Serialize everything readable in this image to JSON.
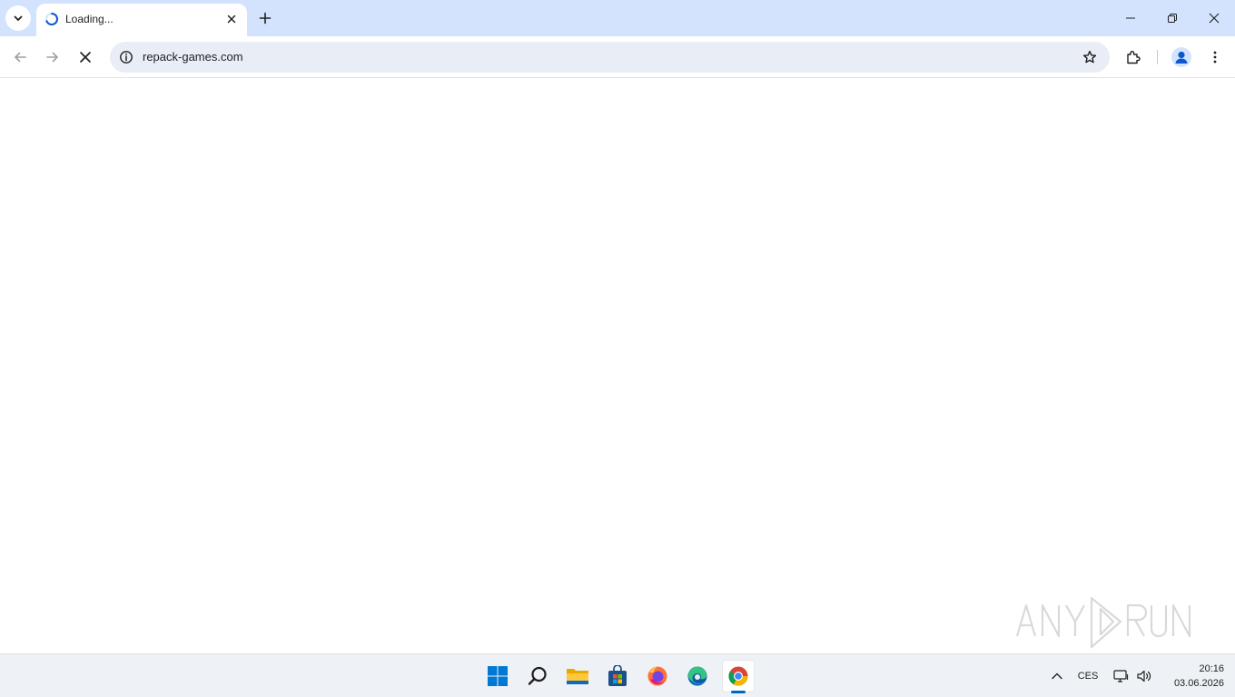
{
  "browser": {
    "tab": {
      "title": "Loading..."
    },
    "address_bar": {
      "url": "repack-games.com"
    }
  },
  "taskbar": {
    "language": "CES",
    "time": "20:16",
    "date": "03.06.2026",
    "pinned": [
      "windows-start-icon",
      "search-icon",
      "file-explorer-icon",
      "microsoft-store-icon",
      "firefox-icon",
      "edge-icon",
      "chrome-icon"
    ]
  },
  "watermark": {
    "text": "ANY RUN"
  },
  "colors": {
    "tabstrip_bg": "#d3e3fd",
    "omnibox_bg": "#e9eef6",
    "accent_blue": "#0b57d0",
    "taskbar_bg": "#eef2f6"
  }
}
